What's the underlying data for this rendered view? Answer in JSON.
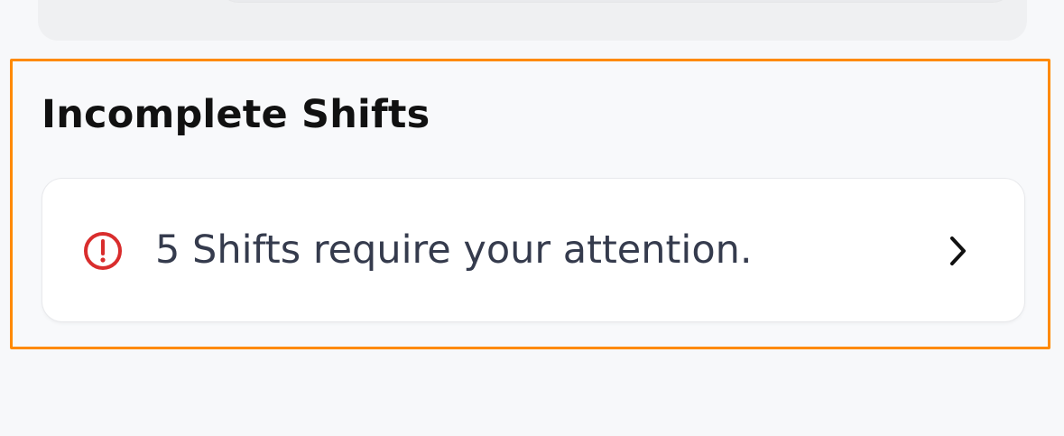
{
  "incomplete_shifts": {
    "title": "Incomplete Shifts",
    "notice": {
      "text": "5 Shifts require your attention.",
      "icon": "alert-circle-icon",
      "chevron_icon": "chevron-right-icon"
    }
  },
  "colors": {
    "highlight_border": "#ff8a00",
    "alert": "#d92d2d",
    "title_text": "#111111",
    "notice_text": "#353b4d"
  }
}
